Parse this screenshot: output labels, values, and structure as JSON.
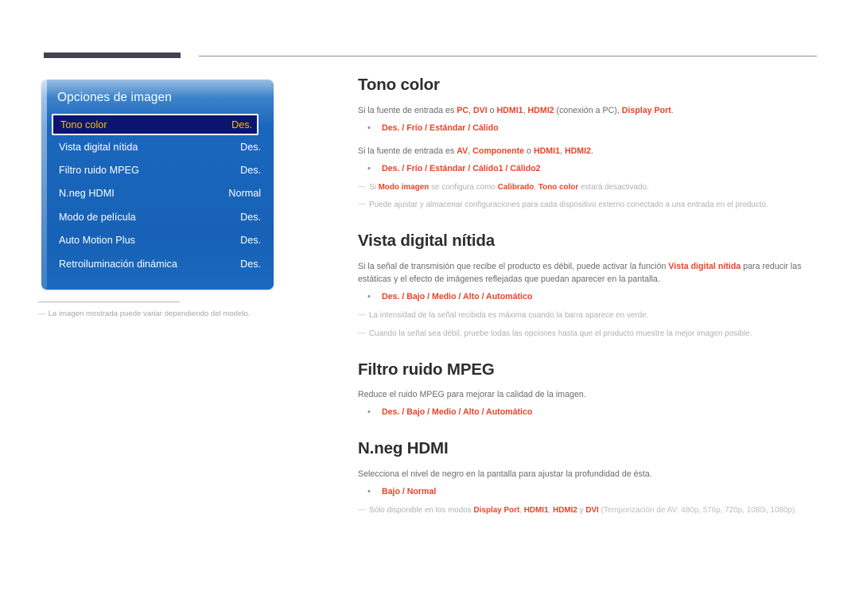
{
  "page": {
    "language": "es",
    "accent_color": "#e8442a",
    "heading_color": "#2d2d2d",
    "body_color": "#6a6a6a",
    "note_color": "#b0b0b0",
    "rule_color": "#454150"
  },
  "osd": {
    "title": "Opciones de imagen",
    "panel_bg_top": "#9bbfe4",
    "panel_bg_main": "#1a67bd",
    "selected_bg": "#0d1470",
    "selected_text": "#f2c200",
    "rows": [
      {
        "label": "Tono color",
        "value": "Des.",
        "selected": true
      },
      {
        "label": "Vista digital nítida",
        "value": "Des.",
        "selected": false
      },
      {
        "label": "Filtro ruido MPEG",
        "value": "Des.",
        "selected": false
      },
      {
        "label": "N.neg HDMI",
        "value": "Normal",
        "selected": false
      },
      {
        "label": "Modo de película",
        "value": "Des.",
        "selected": false
      },
      {
        "label": "Auto Motion Plus",
        "value": "Des.",
        "selected": false
      },
      {
        "label": "Retroiluminación dinámica",
        "value": "Des.",
        "selected": false
      }
    ],
    "image_note_dash": "―",
    "image_note": "La imagen mostrada puede variar dependiendo del modelo."
  },
  "sections": {
    "tono_color": {
      "heading": "Tono color",
      "para1_pre": "Si la fuente de entrada es ",
      "para1_k1": "PC",
      "para1_s1": ", ",
      "para1_k2": "DVI",
      "para1_s2": " o ",
      "para1_k3": "HDMI1",
      "para1_s3": ", ",
      "para1_k4": "HDMI2",
      "para1_s4": " (conexión a PC), ",
      "para1_k5": "Display Port",
      "para1_end": ".",
      "options1": "Des. / Frío / Estándar / Cálido",
      "para2_pre": "Si la fuente de entrada es ",
      "para2_k1": "AV",
      "para2_s1": ", ",
      "para2_k2": "Componente",
      "para2_s2": " o ",
      "para2_k3": "HDMI1",
      "para2_s3": ", ",
      "para2_k4": "HDMI2",
      "para2_end": ".",
      "options2": "Des. / Frío / Estándar / Cálido1 / Cálido2",
      "note1_a": "Si ",
      "note1_k1": "Modo imagen",
      "note1_b": " se configura como ",
      "note1_k2": "Calibrado",
      "note1_c": ", ",
      "note1_k3": "Tono color",
      "note1_d": " estará desactivado.",
      "note2": "Puede ajustar y almacenar configuraciones para cada dispositivo externo conectado a una entrada en el producto."
    },
    "vista_digital": {
      "heading": "Vista digital nítida",
      "para_a": "Si la señal de transmisión que recibe el producto es débil, puede activar la función ",
      "para_k": "Vista digital nítida",
      "para_b": " para reducir las estáticas y el efecto de imágenes reflejadas que puedan aparecer en la pantalla.",
      "options": "Des. / Bajo / Medio / Alto / Automático",
      "note1": "La intensidad de la señal recibida es máxima cuando la barra aparece en verde.",
      "note2": "Cuando la señal sea débil, pruebe todas las opciones hasta que el producto muestre la mejor imagen posible."
    },
    "filtro_mpeg": {
      "heading": "Filtro ruido MPEG",
      "para": "Reduce el ruido MPEG para mejorar la calidad de la imagen.",
      "options": "Des. / Bajo / Medio / Alto / Automático"
    },
    "nneg_hdmi": {
      "heading": "N.neg HDMI",
      "para": "Selecciona el nivel de negro en la pantalla para ajustar la profundidad de ésta.",
      "options": "Bajo / Normal",
      "note_a": "Sólo disponible en los modos ",
      "note_k1": "Display Port",
      "note_b": ", ",
      "note_k2": "HDMI1",
      "note_c": ", ",
      "note_k3": "HDMI2",
      "note_d": " y ",
      "note_k4": "DVI",
      "note_e": " (Temporización de AV: 480p, 576p, 720p, 1080i, 1080p)."
    }
  }
}
